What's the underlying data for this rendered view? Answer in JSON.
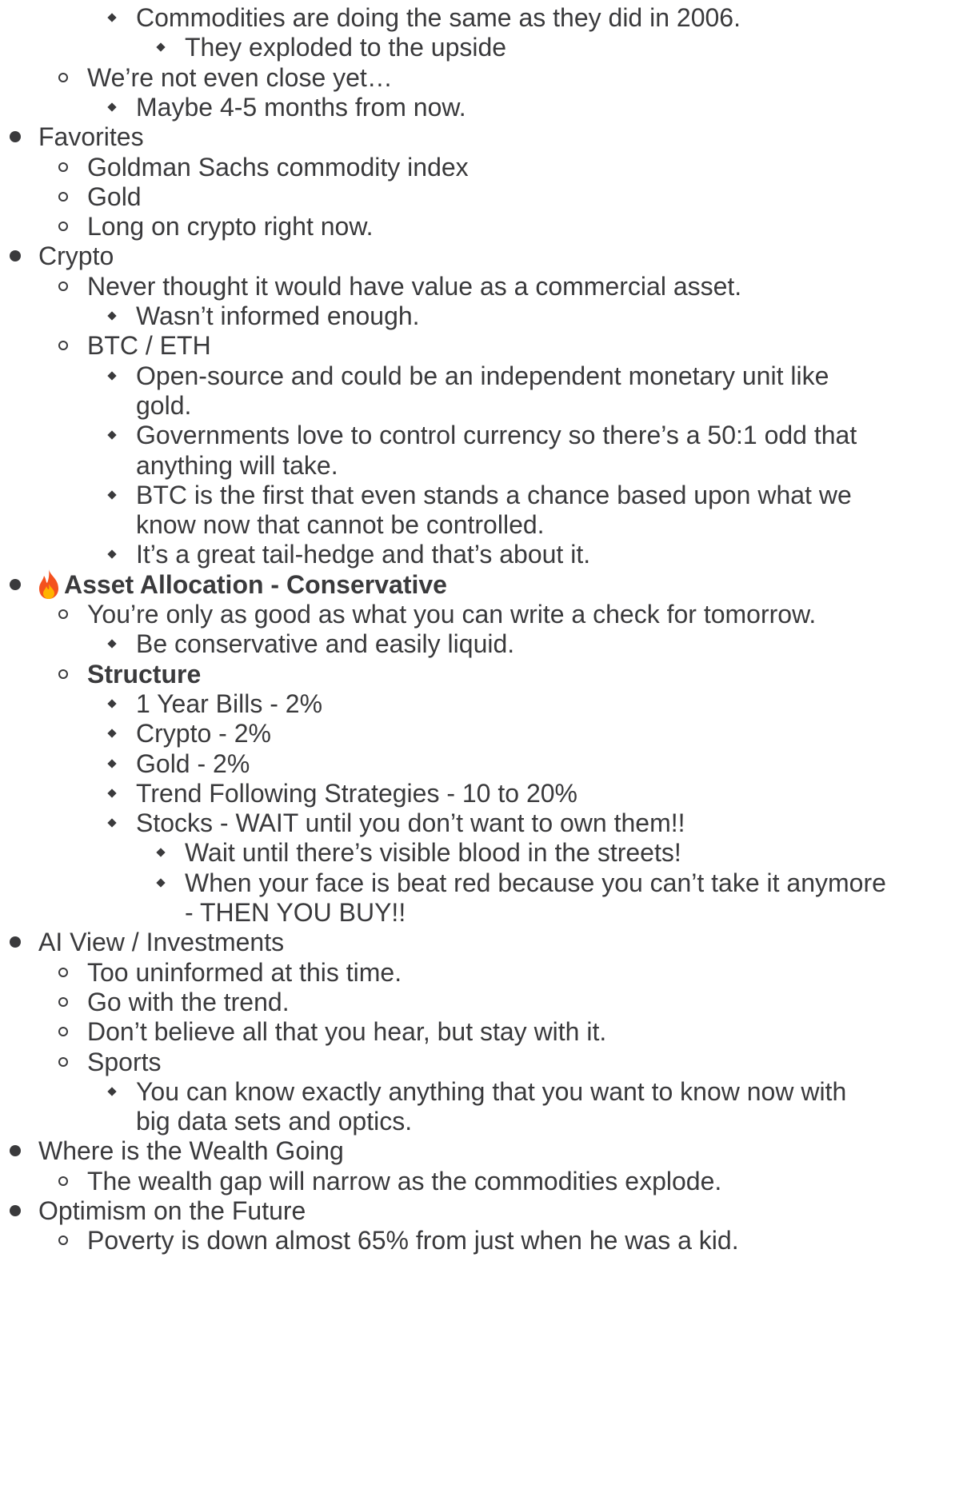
{
  "outline": [
    {
      "level": 3,
      "text": "Commodities are doing the same as they did in 2006."
    },
    {
      "level": 4,
      "text": "They exploded to the upside"
    },
    {
      "level": 2,
      "text": "We’re not even close yet…"
    },
    {
      "level": 3,
      "text": "Maybe 4-5 months from now."
    },
    {
      "level": 1,
      "text": "Favorites"
    },
    {
      "level": 2,
      "text": "Goldman Sachs commodity index"
    },
    {
      "level": 2,
      "text": "Gold"
    },
    {
      "level": 2,
      "text": "Long on crypto right now."
    },
    {
      "level": 1,
      "text": "Crypto"
    },
    {
      "level": 2,
      "text": "Never thought it would have value as a commercial asset."
    },
    {
      "level": 3,
      "text": "Wasn’t informed enough."
    },
    {
      "level": 2,
      "text": "BTC / ETH"
    },
    {
      "level": 3,
      "text": "Open-source and could be an independent monetary unit like"
    },
    {
      "level": 3,
      "continuation": true,
      "text": "gold."
    },
    {
      "level": 3,
      "text": "Governments love to control currency so there’s a 50:1 odd that"
    },
    {
      "level": 3,
      "continuation": true,
      "text": "anything will take."
    },
    {
      "level": 3,
      "text": "BTC is the first that even stands a chance based upon what we"
    },
    {
      "level": 3,
      "continuation": true,
      "text": "know now that cannot be controlled."
    },
    {
      "level": 3,
      "text": "It’s a great tail-hedge and that’s about it."
    },
    {
      "level": 1,
      "bold": true,
      "icon": "fire-icon",
      "text": "Asset Allocation - Conservative"
    },
    {
      "level": 2,
      "text": "You’re only as good as what you can write a check for tomorrow."
    },
    {
      "level": 3,
      "text": "Be conservative and easily liquid."
    },
    {
      "level": 2,
      "bold": true,
      "text": "Structure"
    },
    {
      "level": 3,
      "text": "1 Year Bills - 2%"
    },
    {
      "level": 3,
      "text": "Crypto - 2%"
    },
    {
      "level": 3,
      "text": "Gold - 2%"
    },
    {
      "level": 3,
      "text": "Trend Following Strategies - 10 to 20%"
    },
    {
      "level": 3,
      "text": "Stocks - WAIT until you don’t want to own them!!"
    },
    {
      "level": 4,
      "text": "Wait until there’s visible blood in the streets!"
    },
    {
      "level": 4,
      "text": "When your face is beat red because you can’t take it anymore"
    },
    {
      "level": 4,
      "continuation": true,
      "text": "- THEN YOU BUY!!"
    },
    {
      "level": 1,
      "text": "AI View / Investments"
    },
    {
      "level": 2,
      "text": "Too uninformed at this time."
    },
    {
      "level": 2,
      "text": "Go with the trend."
    },
    {
      "level": 2,
      "text": "Don’t believe all that you hear, but stay with it."
    },
    {
      "level": 2,
      "text": "Sports"
    },
    {
      "level": 3,
      "text": "You can know exactly anything that you want to know now with"
    },
    {
      "level": 3,
      "continuation": true,
      "text": "big data sets and optics."
    },
    {
      "level": 1,
      "text": "Where is the Wealth Going"
    },
    {
      "level": 2,
      "text": "The wealth gap will narrow as the commodities explode."
    },
    {
      "level": 1,
      "text": "Optimism on the Future"
    },
    {
      "level": 2,
      "text": "Poverty is down almost 65% from just when he was a kid."
    }
  ]
}
